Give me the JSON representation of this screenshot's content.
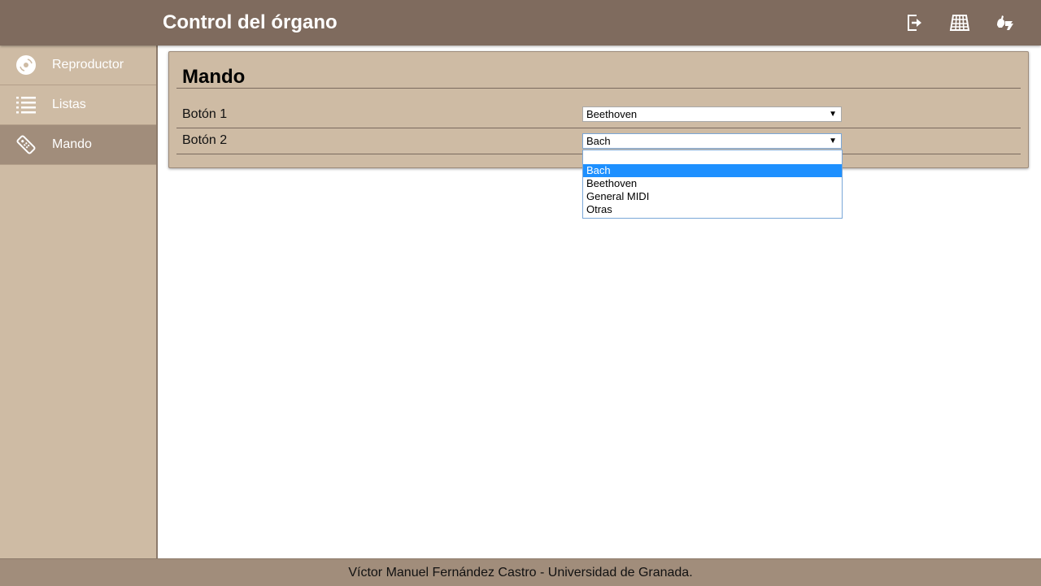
{
  "header": {
    "title": "Control del órgano",
    "icons": [
      "logout-icon",
      "keyboard-icon",
      "sign-language-icon"
    ]
  },
  "sidebar": {
    "items": [
      {
        "label": "Reproductor",
        "icon": "disc-icon",
        "active": false
      },
      {
        "label": "Listas",
        "icon": "list-icon",
        "active": false
      },
      {
        "label": "Mando",
        "icon": "remote-control-icon",
        "active": true
      }
    ]
  },
  "main": {
    "title": "Mando",
    "rows": [
      {
        "label": "Botón 1",
        "value": "Beethoven"
      },
      {
        "label": "Botón 2",
        "value": "Bach"
      }
    ],
    "dropdown": {
      "options": [
        "",
        "Bach",
        "Beethoven",
        "General MIDI",
        "Otras"
      ],
      "selected": "Bach"
    },
    "arrow_glyph": "▼"
  },
  "footer": {
    "text": "Víctor Manuel Fernández Castro - Universidad de Granada."
  },
  "colors": {
    "header": "#7f6b5e",
    "sidebar": "#cebba4",
    "active_item": "#a18d7b",
    "selection": "#1e90ff"
  }
}
